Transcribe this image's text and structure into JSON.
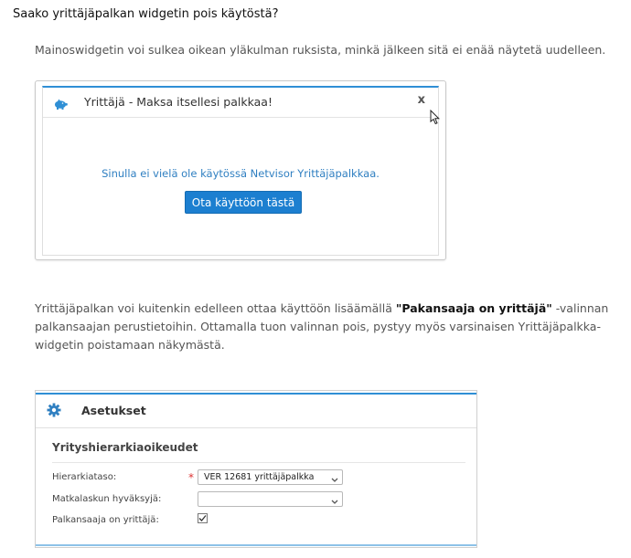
{
  "question": {
    "title": "Saako yrittäjäpalkan widgetin pois käytöstä?"
  },
  "intro": {
    "text": "Mainoswidgetin voi sulkea oikean yläkulman ruksista, minkä jälkeen sitä ei enää näytetä uudelleen."
  },
  "widget": {
    "icon": "piggy-bank-icon",
    "title": "Yrittäjä - Maksa itsellesi palkkaa!",
    "close_label": "x",
    "message": "Sinulla ei vielä ole käytössä Netvisor Yrittäjäpalkkaa.",
    "button_label": "Ota käyttöön tästä",
    "accent": "#1c7fd0"
  },
  "explanation": {
    "text_before": "Yrittäjäpalkan voi kuitenkin edelleen ottaa käyttöön lisäämällä ",
    "bold": "\"Pakansaaja on yrittäjä\"",
    "text_after": " -valinnan palkansaajan perustietoihin. Ottamalla tuon valinnan pois, pystyy myös varsinaisen Yrittäjäpalkka-widgetin poistamaan näkymästä."
  },
  "settings": {
    "icon": "gear-icon",
    "title": "Asetukset",
    "section": "Yrityshierarkiaoikeudet",
    "fields": [
      {
        "label": "Hierarkiataso:",
        "required": "*",
        "value": "VER 12681 yrittäjäpalkka"
      },
      {
        "label": "Matkalaskun hyväksyjä:",
        "value": ""
      },
      {
        "label": "Palkansaaja on yrittäjä:",
        "checked": true
      }
    ]
  }
}
